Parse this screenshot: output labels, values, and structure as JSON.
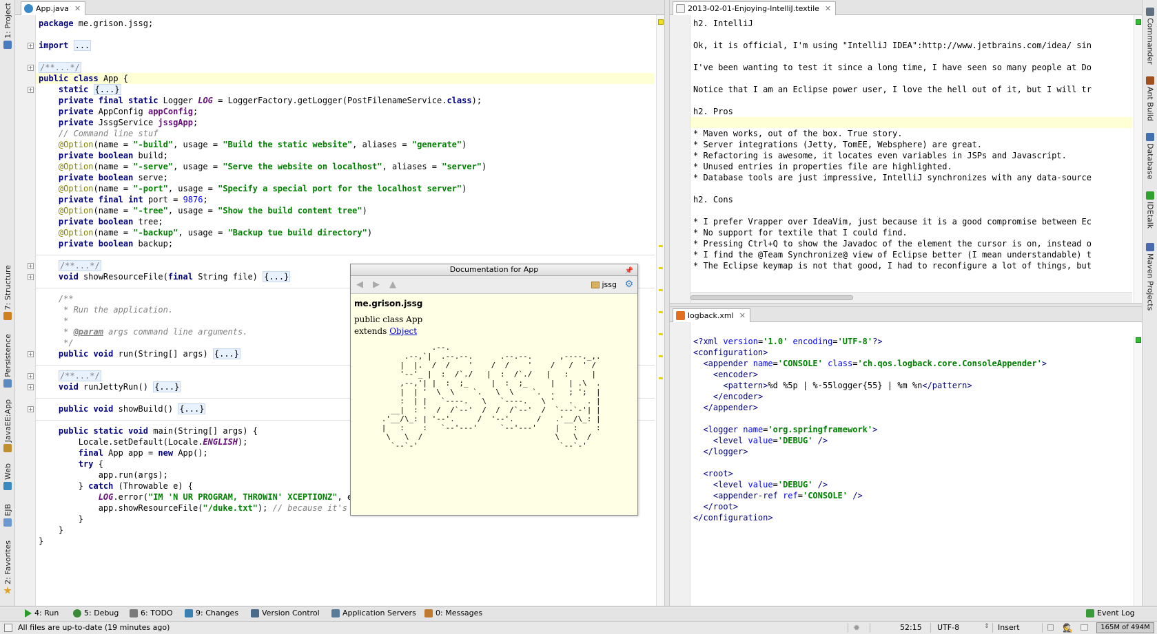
{
  "left_stripe": [
    {
      "label": "1: Project",
      "icon": "project-icon",
      "color": "#4a7cc0"
    },
    {
      "label": "7: Structure",
      "icon": "structure-icon",
      "color": "#d08020"
    },
    {
      "label": "Persistence",
      "icon": "persistence-icon",
      "color": "#5a8ac0"
    },
    {
      "label": "JavaEE:App",
      "icon": "javaee-icon",
      "color": "#c09030"
    },
    {
      "label": "Web",
      "icon": "web-icon",
      "color": "#3a8ac0"
    },
    {
      "label": "EJB",
      "icon": "ejb-icon",
      "color": "#6a9ad0"
    },
    {
      "label": "2: Favorites",
      "icon": "star-icon",
      "color": "#e0a020"
    }
  ],
  "right_stripe": [
    {
      "label": "Commander",
      "icon": "commander-icon",
      "color": "#607080"
    },
    {
      "label": "Ant Build",
      "icon": "ant-icon",
      "color": "#a05020"
    },
    {
      "label": "Database",
      "icon": "database-icon",
      "color": "#4070b0"
    },
    {
      "label": "IDEtalk",
      "icon": "idetalk-icon",
      "color": "#30a030"
    },
    {
      "label": "Maven Projects",
      "icon": "maven-icon",
      "color": "#4a6ab0"
    }
  ],
  "left_editor": {
    "tab": "App.java",
    "lines": [
      "package me.grison.jssg;",
      "",
      "import ...",
      "",
      "/**...*/",
      "public class App {",
      "    static {...}",
      "    private final static Logger LOG = LoggerFactory.getLogger(PostFilenameService.class);",
      "    private AppConfig appConfig;",
      "    private JssgService jssgApp;",
      "    // Command line stuf",
      "    @Option(name = \"-build\", usage = \"Build the static website\", aliases = \"generate\")",
      "    private boolean build;",
      "    @Option(name = \"-serve\", usage = \"Serve the website on localhost\", aliases = \"server\")",
      "    private boolean serve;",
      "    @Option(name = \"-port\", usage = \"Specify a special port for the localhost server\")",
      "    private final int port = 9876;",
      "    @Option(name = \"-tree\", usage = \"Show the build content tree\")",
      "    private boolean tree;",
      "    @Option(name = \"-backup\", usage = \"Backup tue build directory\")",
      "    private boolean backup;",
      "",
      "    /**...*/",
      "    void showResourceFile(final String file) {...}",
      "",
      "    /**",
      "     * Run the application.",
      "     *",
      "     * @param args command line arguments.",
      "     */",
      "    public void run(String[] args) {...}",
      "",
      "    /**...*/",
      "    void runJettyRun() {...}",
      "",
      "    public void showBuild() {...}",
      "",
      "    public static void main(String[] args) {",
      "        Locale.setDefault(Locale.ENGLISH);",
      "        final App app = new App();",
      "        try {",
      "            app.run(args);",
      "        } catch (Throwable e) {",
      "            LOG.error(\"IM 'N UR PROGRAM, THROWIN' XCEPTIONZ\", e);",
      "            app.showResourceFile(\"/duke.txt\"); // because it's fun",
      "        }",
      "    }",
      "}"
    ]
  },
  "textile_editor": {
    "tab": "2013-02-01-Enjoying-IntelliJ.textile",
    "lines": [
      "h2. IntelliJ",
      "",
      "Ok, it is official, I'm using \"IntelliJ IDEA\":http://www.jetbrains.com/idea/ sin",
      "",
      "I've been wanting to test it since a long time, I have seen so many people at Do",
      "",
      "Notice that I am an Eclipse power user, I love the hell out of it, but I will tr",
      "",
      "h2. Pros",
      "",
      "* Maven works, out of the box. True story.",
      "* Server integrations (Jetty, TomEE, Websphere) are great.",
      "* Refactoring is awesome, it locates even variables in JSPs and Javascript.",
      "* Unused entries in properties file are highlighted.",
      "* Database tools are just impressive, IntelliJ synchronizes with any data-source",
      "",
      "h2. Cons",
      "",
      "* I prefer Vrapper over IdeaVim, just because it is a good compromise between Ec",
      "* No support for textile that I could find.",
      "* Pressing Ctrl+Q to show the Javadoc of the element the cursor is on, instead o",
      "* I find the @Team Synchronize@ view of Eclipse better (I mean understandable) t",
      "* The Eclipse keymap is not that good, I had to reconfigure a lot of things, but"
    ]
  },
  "xml_editor": {
    "tab": "logback.xml",
    "lines": [
      "<?xml version='1.0' encoding='UTF-8'?>",
      "<configuration>",
      "  <appender name='CONSOLE' class='ch.qos.logback.core.ConsoleAppender'>",
      "    <encoder>",
      "      <pattern>%d %5p | %-55logger{55} | %m %n</pattern>",
      "    </encoder>",
      "  </appender>",
      "",
      "  <logger name='org.springframework'>",
      "    <level value='DEBUG' />",
      "  </logger>",
      "",
      "  <root>",
      "    <level value='DEBUG' />",
      "    <appender-ref ref='CONSOLE' />",
      "  </root>",
      "</configuration>"
    ]
  },
  "doc_popup": {
    "title": "Documentation for App",
    "package_chip": "jssg",
    "package_name": "me.grison.jssg",
    "signature_line1": "public class App",
    "extends_label": "extends",
    "extends_link": "Object",
    "ascii_art": "                 .--.\n           .--,`|  .--.--.      .--.--.      ,----._,.\n          |  |.  /  /    '    /  /    '    /   /  ' /\n          '--'_ |  :  /`./   |  :  /`./   |   :     |\n          ,--,'| |  :  ;_     |  :  ;_     |   | .\\  .\n          |  | '  \\  \\    `.   \\  \\    `.  .   ; ';  |\n          :  | |   `----.   \\   `----.   \\ '   .   . |\n        __|  : '  /  /`--'  /  /  /`--'  /  `---`-'| |\n      .'__/\\_: | '--'.     /  '--'.     /   .'__/\\_: |\n      |   :    :   `--'---'     `--'---'    |   :    :\n       \\   \\  /                             \\   \\  /\n        `--`-'                               `--`-'"
  },
  "bottom_tools": [
    {
      "label": "4: Run",
      "icon": "run-icon",
      "color": "#2a9a2a"
    },
    {
      "label": "5: Debug",
      "icon": "debug-icon",
      "color": "#3a8a3a"
    },
    {
      "label": "6: TODO",
      "icon": "todo-icon",
      "color": "#7a7a7a"
    },
    {
      "label": "9: Changes",
      "icon": "changes-icon",
      "color": "#3a80b0"
    },
    {
      "label": "Version Control",
      "icon": "vcs-icon",
      "color": "#4a6a8a"
    },
    {
      "label": "Application Servers",
      "icon": "server-icon",
      "color": "#5a7a9a"
    },
    {
      "label": "0: Messages",
      "icon": "messages-icon",
      "color": "#c07a30"
    },
    {
      "label": "Event Log",
      "icon": "event-log-icon",
      "color": "#3a9a3a"
    }
  ],
  "status_bar": {
    "message": "All files are up-to-date (19 minutes ago)",
    "position": "52:15",
    "encoding": "UTF-8",
    "insert_mode": "Insert",
    "memory": "165M of 494M"
  }
}
